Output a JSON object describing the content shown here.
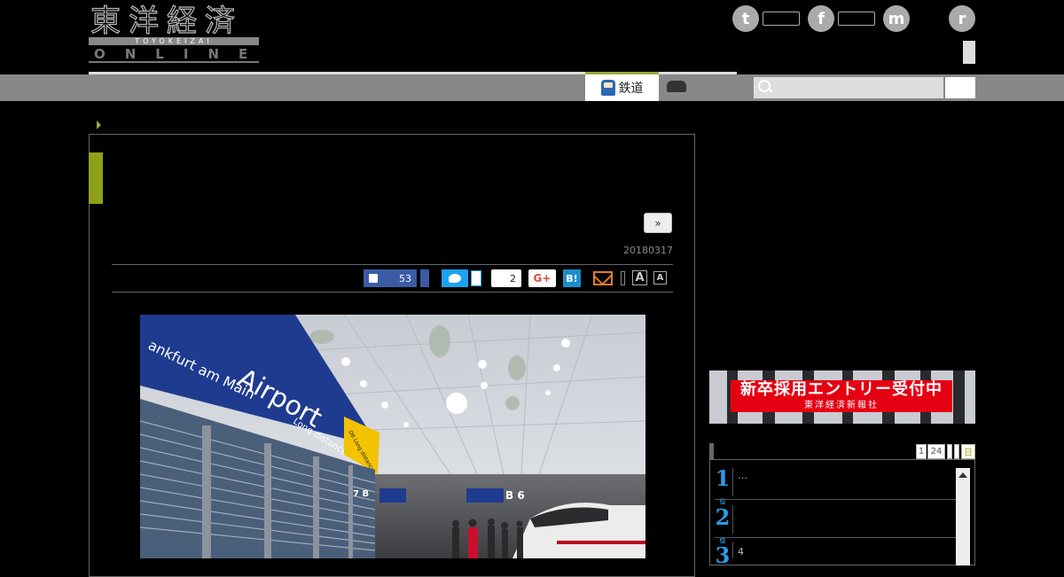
{
  "logo": {
    "kanji": "東洋経済",
    "romaji": "TOYOKEIZAI",
    "online": "ONLINE"
  },
  "header": {
    "social": [
      {
        "name": "twitter",
        "glyph": "t"
      },
      {
        "name": "facebook",
        "glyph": "f"
      },
      {
        "name": "messenger",
        "glyph": "m"
      },
      {
        "name": "rss",
        "glyph": "r"
      }
    ]
  },
  "nav": {
    "active_tab": "鉄道"
  },
  "article": {
    "next_label": "»",
    "date": "20180317",
    "share": {
      "like_count": "53",
      "hatena_count": "2",
      "gplus": "G+",
      "hatebu": "B!"
    },
    "font_large": "A",
    "font_small": "A"
  },
  "photo": {
    "sign_main": "Airport",
    "sign_left": "ankfurt am Main",
    "sign_right": "Long distance trains",
    "yellow_sign": "DB Long distance",
    "platform_b": "B 6",
    "platform_7b": "7 B"
  },
  "banner": {
    "main": "新卒採用エントリー受付中",
    "sub": "東洋経済新報社"
  },
  "ranking": {
    "tabs": [
      "1",
      "24",
      "",
      "",
      "日"
    ],
    "items": [
      {
        "rank": "1",
        "suffix": "位",
        "text": "…"
      },
      {
        "rank": "2",
        "suffix": "位",
        "text": ""
      },
      {
        "rank": "3",
        "suffix": "位",
        "text": "4"
      }
    ]
  },
  "colors": {
    "accent_green": "#8fa018",
    "db_blue": "#1f3b8f",
    "banner_red": "#e50012",
    "rank_blue": "#2d9be8"
  }
}
